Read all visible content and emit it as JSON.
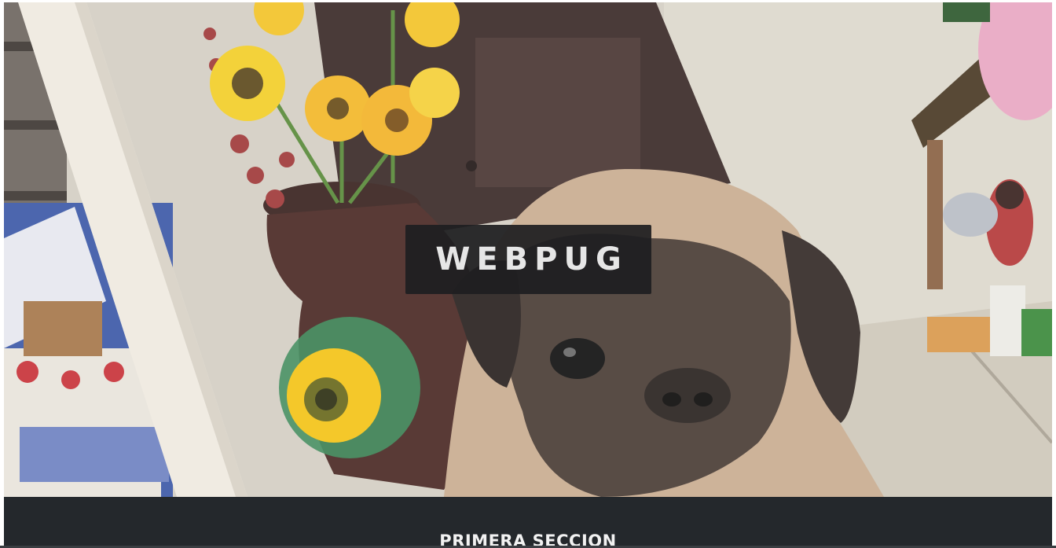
{
  "hero": {
    "brand_title": "WEBPUG",
    "photo_icon": "pug-photo"
  },
  "section": {
    "title": "PRIMERA SECCION"
  },
  "colors": {
    "overlay": "#1e1e20",
    "brand_text": "#e6e6e6",
    "section_bg": "#24282c",
    "section_text": "#f2f2f2"
  }
}
